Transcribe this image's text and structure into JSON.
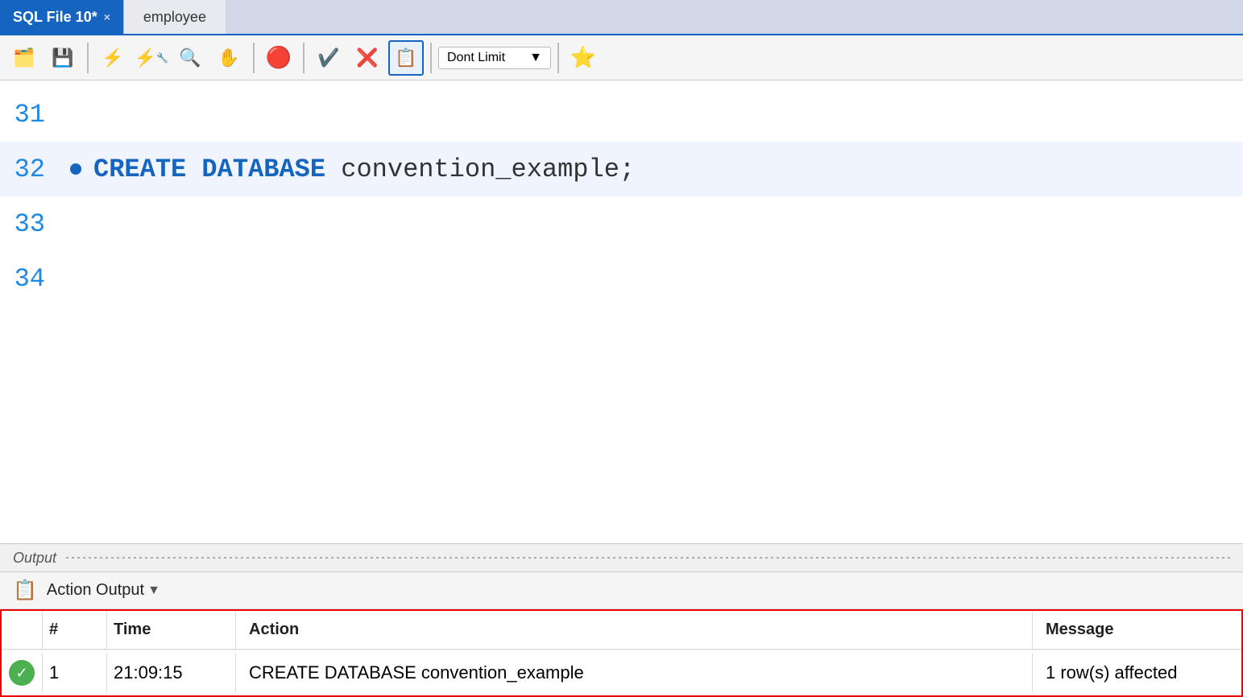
{
  "tabs": {
    "active": {
      "label": "SQL File 10*",
      "close": "×"
    },
    "inactive": {
      "label": "employee"
    }
  },
  "toolbar": {
    "limit_label": "Dont Limit",
    "dropdown_arrow": "▼"
  },
  "editor": {
    "lines": [
      {
        "num": "31",
        "bullet": false,
        "active": false,
        "content": "",
        "parts": []
      },
      {
        "num": "32",
        "bullet": true,
        "active": true,
        "content": "CREATE DATABASE convention_example;",
        "parts": [
          {
            "text": "CREATE DATABASE ",
            "class": "kw-blue"
          },
          {
            "text": "convention_example;",
            "class": "kw-dark"
          }
        ]
      },
      {
        "num": "33",
        "bullet": false,
        "active": false,
        "content": "",
        "parts": []
      },
      {
        "num": "34",
        "bullet": false,
        "active": false,
        "content": "",
        "parts": []
      }
    ]
  },
  "output": {
    "label": "Output",
    "action_output_label": "Action Output",
    "table": {
      "headers": [
        "",
        "#",
        "Time",
        "Action",
        "Message"
      ],
      "rows": [
        {
          "status": "success",
          "num": "1",
          "time": "21:09:15",
          "action": "CREATE DATABASE convention_example",
          "message": "1 row(s) affected"
        }
      ]
    }
  }
}
